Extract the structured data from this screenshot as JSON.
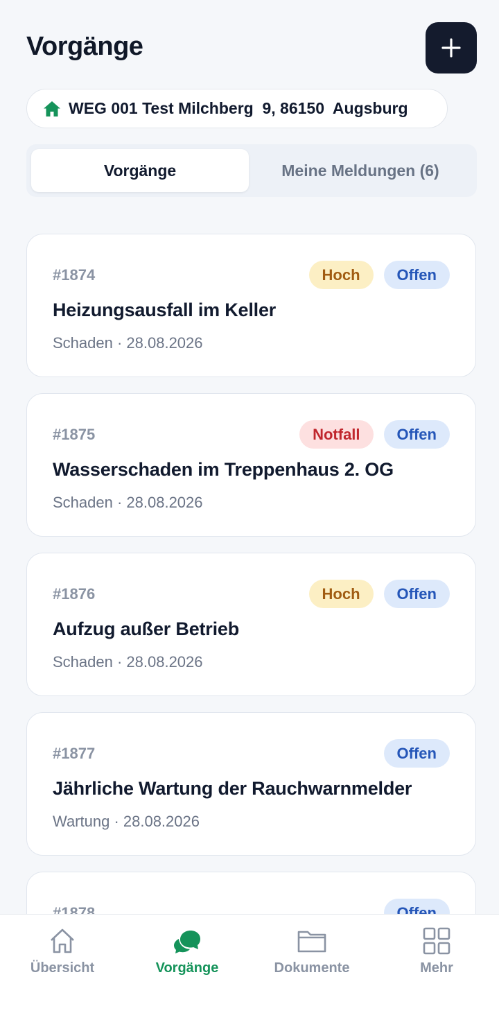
{
  "header": {
    "title": "Vorgänge",
    "add_icon": "plus-icon"
  },
  "property": {
    "icon": "home-icon",
    "label": "WEG 001 Test Milchberg  9, 86150  Augsburg",
    "icon_color": "#15935a"
  },
  "tabs": [
    {
      "label": "Vorgänge",
      "active": true
    },
    {
      "label": "Meine Meldungen (6)",
      "active": false
    }
  ],
  "cases": [
    {
      "id": "#1874",
      "badges": [
        {
          "label": "Hoch",
          "type": "hoch"
        },
        {
          "label": "Offen",
          "type": "offen"
        }
      ],
      "title": "Heizungsausfall im Keller",
      "meta": "Schaden · 28.08.2026"
    },
    {
      "id": "#1875",
      "badges": [
        {
          "label": "Notfall",
          "type": "notfall"
        },
        {
          "label": "Offen",
          "type": "offen"
        }
      ],
      "title": "Wasserschaden im Treppenhaus 2. OG",
      "meta": "Schaden · 28.08.2026"
    },
    {
      "id": "#1876",
      "badges": [
        {
          "label": "Hoch",
          "type": "hoch"
        },
        {
          "label": "Offen",
          "type": "offen"
        }
      ],
      "title": "Aufzug außer Betrieb",
      "meta": "Schaden · 28.08.2026"
    },
    {
      "id": "#1877",
      "badges": [
        {
          "label": "Offen",
          "type": "offen"
        }
      ],
      "title": "Jährliche Wartung der Rauchwarnmelder",
      "meta": "Wartung · 28.08.2026"
    },
    {
      "id": "#1878",
      "badges": [
        {
          "label": "Offen",
          "type": "offen"
        }
      ],
      "title": "",
      "meta": ""
    }
  ],
  "nav": [
    {
      "label": "Übersicht",
      "icon": "home-icon",
      "active": false
    },
    {
      "label": "Vorgänge",
      "icon": "chat-icon",
      "active": true
    },
    {
      "label": "Dokumente",
      "icon": "folder-icon",
      "active": false
    },
    {
      "label": "Mehr",
      "icon": "grid-icon",
      "active": false
    }
  ],
  "colors": {
    "accent": "#15935a",
    "dark": "#141b2d",
    "hoch": "#a15c12",
    "notfall": "#c0262d",
    "offen": "#2556b8"
  }
}
